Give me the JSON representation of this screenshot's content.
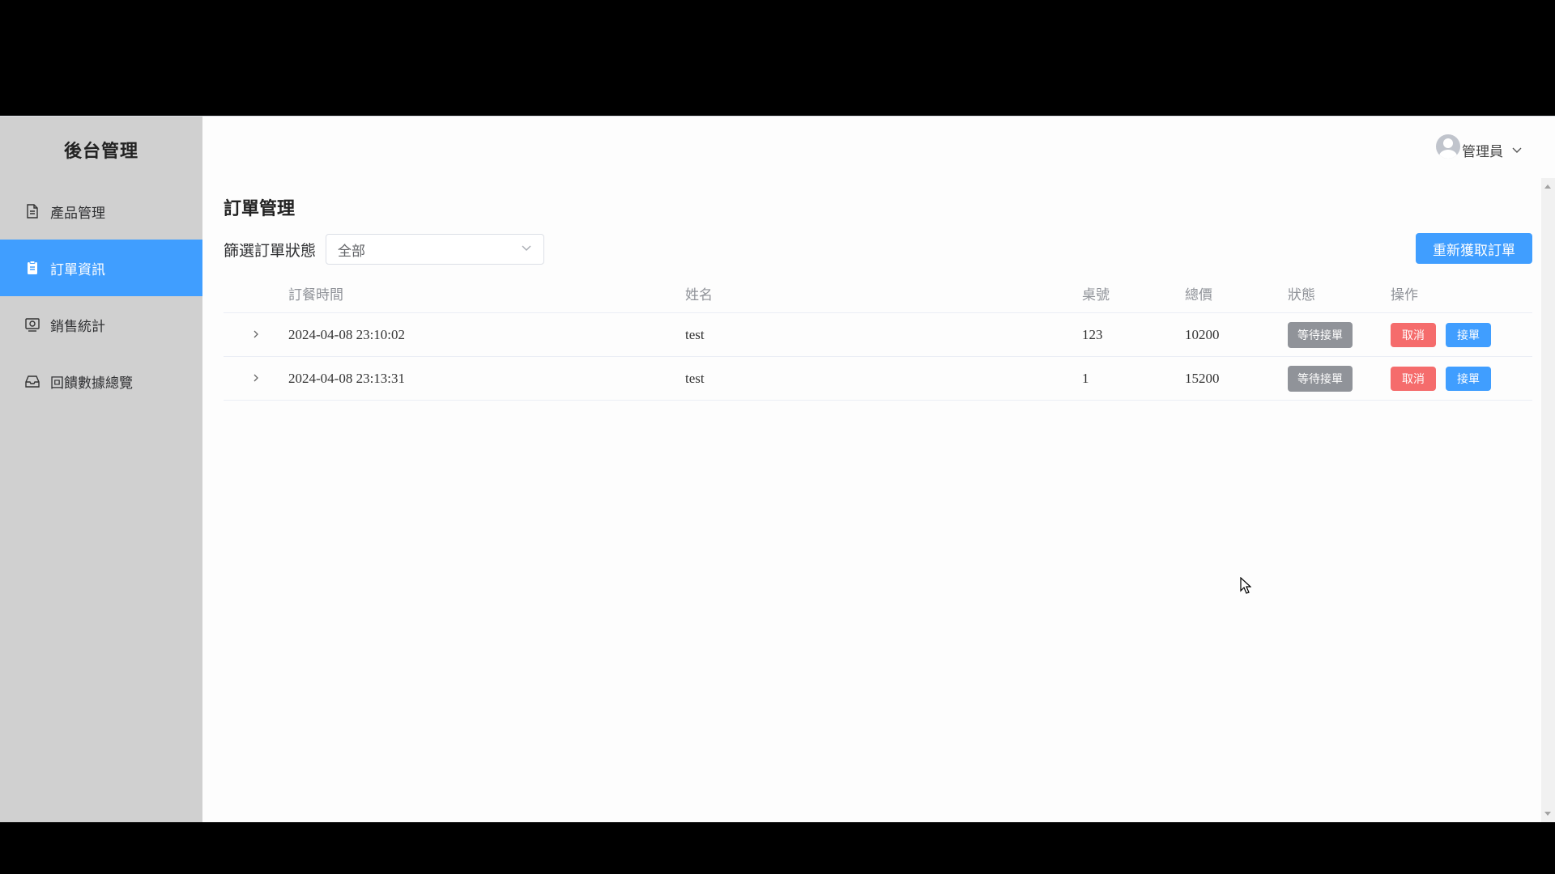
{
  "sidebar": {
    "brand": "後台管理",
    "items": [
      {
        "label": "產品管理",
        "icon": "document-icon"
      },
      {
        "label": "訂單資訊",
        "icon": "clipboard-icon"
      },
      {
        "label": "銷售統計",
        "icon": "chart-card-icon"
      },
      {
        "label": "回饋數據總覽",
        "icon": "inbox-icon"
      }
    ],
    "active_index": 1
  },
  "header": {
    "user_name": "管理員"
  },
  "main": {
    "title": "訂單管理",
    "filter_label": "篩選訂單狀態",
    "filter_value": "全部",
    "refresh_button": "重新獲取訂單",
    "columns": [
      "訂餐時間",
      "姓名",
      "桌號",
      "總價",
      "狀態",
      "操作"
    ],
    "rows": [
      {
        "time": "2024-04-08 23:10:02",
        "name": "test",
        "table": "123",
        "total": "10200",
        "status": "等待接單",
        "cancel": "取消",
        "accept": "接單"
      },
      {
        "time": "2024-04-08 23:13:31",
        "name": "test",
        "table": "1",
        "total": "15200",
        "status": "等待接單",
        "cancel": "取消",
        "accept": "接單"
      }
    ]
  },
  "colors": {
    "primary": "#409eff",
    "danger": "#f56c6c",
    "info": "#909399",
    "sidebar_bg": "#d0d0d0"
  }
}
